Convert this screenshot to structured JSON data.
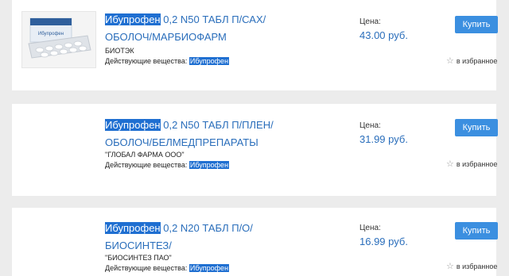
{
  "products": [
    {
      "title_highlight": "Ибупрофен",
      "title_line1_rest": " 0,2 N50 ТАБЛ П/САХ/",
      "title_line2": "ОБОЛОЧ/МАРБИОФАРМ",
      "manufacturer": "БИОТЭК",
      "substance_label": "Действующие вещества:",
      "substance_value": "Ибупрофен",
      "price_label": "Цена:",
      "price": "43.00 руб.",
      "buy_label": "Купить",
      "fav_label": "в избранное",
      "image_label": "Ибупрофен"
    },
    {
      "title_highlight": "Ибупрофен",
      "title_line1_rest": " 0,2 N50 ТАБЛ П/ПЛЕН/",
      "title_line2": "ОБОЛОЧ/БЕЛМЕДПРЕПАРАТЫ",
      "manufacturer": "\"ГЛОБАЛ ФАРМА ООО\"",
      "substance_label": "Действующие вещества:",
      "substance_value": "Ибупрофен",
      "price_label": "Цена:",
      "price": "31.99 руб.",
      "buy_label": "Купить",
      "fav_label": "в избранное"
    },
    {
      "title_highlight": "Ибупрофен",
      "title_line1_rest": " 0,2 N20 ТАБЛ П/О/",
      "title_line2": "БИОСИНТЕЗ/",
      "manufacturer": "\"БИОСИНТЕЗ ПАО\"",
      "substance_label": "Действующие вещества:",
      "substance_value": "Ибупрофен",
      "price_label": "Цена:",
      "price": "16.99 руб.",
      "buy_label": "Купить",
      "fav_label": "в избранное"
    }
  ],
  "colors": {
    "link": "#2a6ebb",
    "highlight": "#1f6fd1",
    "button": "#3b8fe0",
    "background": "#ececec"
  },
  "icons": {
    "favorite": "star-outline-icon"
  }
}
